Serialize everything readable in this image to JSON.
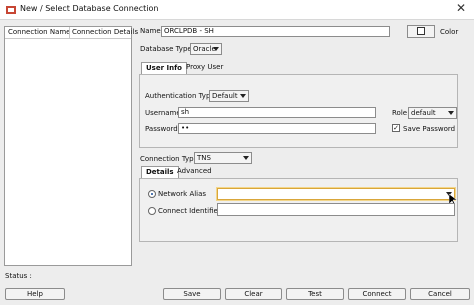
{
  "window": {
    "title": "New / Select Database Connection",
    "close_label": "✕"
  },
  "connections": {
    "col_name": "Connection Name",
    "col_details": "Connection Details"
  },
  "form": {
    "name_label": "Name",
    "name_value": "ORCLPDB - SH",
    "color_label": "Color",
    "db_type_label": "Database Type",
    "db_type_value": "Oracle"
  },
  "tabs_top": {
    "user_info": "User Info",
    "proxy_user": "Proxy User"
  },
  "user_info": {
    "auth_type_label": "Authentication Type",
    "auth_type_value": "Default",
    "username_label": "Username",
    "username_value": "sh",
    "role_label": "Role",
    "role_value": "default",
    "password_label": "Password",
    "password_value": "••",
    "save_password_label": "Save Password",
    "save_password_checked": true
  },
  "connection": {
    "type_label": "Connection Type",
    "type_value": "TNS"
  },
  "tabs_details": {
    "details": "Details",
    "advanced": "Advanced"
  },
  "details": {
    "network_alias_label": "Network Alias",
    "network_alias_selected": true,
    "network_alias_value": "",
    "connect_identifier_label": "Connect Identifier",
    "connect_identifier_value": ""
  },
  "status": {
    "label": "Status :"
  },
  "buttons": {
    "help": "Help",
    "save": "Save",
    "clear": "Clear",
    "test": "Test",
    "connect": "Connect",
    "cancel": "Cancel"
  }
}
